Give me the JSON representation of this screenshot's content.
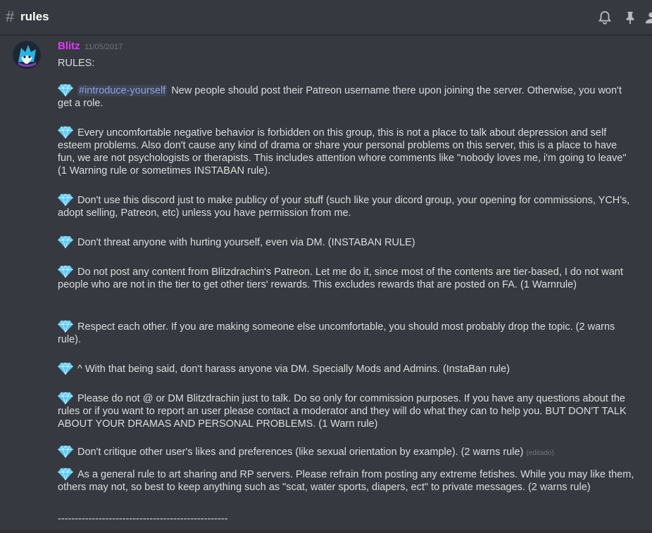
{
  "header": {
    "hash": "#",
    "channel": "rules"
  },
  "message": {
    "author": "Blitz",
    "timestamp": "11/05/2017",
    "author_color": "#e535ff",
    "title": "RULES:",
    "mention": "#introduce-yourself",
    "rules": [
      "New people should post their Patreon username  there upon joining the server. Otherwise, you won't get a role.",
      "Every uncomfortable negative behavior  is forbidden on this group, this is not a place to talk about depression and self esteem problems. Also don't cause any kind of drama or share your personal problems on this server, this is a place to have fun, we are not psychologists or therapists. This includes attention whore comments like \"nobody loves me, i'm going to leave\" (1 Warning rule or sometimes INSTABAN rule).",
      "Don't use this discord just to make publicy of your stuff (such like your dicord group, your opening for commissions, YCH's, adopt selling, Patreon, etc) unless you have permission from me.",
      "Don't threat anyone with hurting yourself, even via DM. (INSTABAN RULE)",
      "Do not post any content from Blitzdrachin's Patreon. Let me do it, since most of the contents are tier-based, I do not want people who are not in the tier to get other tiers' rewards. This excludes rewards that are posted on FA. (1 Warnrule)",
      "Respect each other. If you are making someone else uncomfortable, you should most probably drop the topic. (2 warns rule).",
      "^ With that being said, don't harass anyone via DM. Specially Mods and Admins.  (InstaBan rule)",
      "Please do not @ or DM Blitzdrachin just to talk. Do so only for commission purposes. If you have any questions about the rules or if you want to report an user please contact a moderator and they will do what they can to help you. BUT DON'T TALK ABOUT YOUR DRAMAS AND PERSONAL PROBLEMS.  (1 Warn rule)",
      "Don't critique other user's likes and preferences (like sexual orientation by example). (2 warns rule)",
      "As a general rule to art sharing and RP servers. Please refrain from posting any extreme fetishes. While you may like them, others may not, so best to keep anything such as \"scat, water sports, diapers, ect\" to private messages. (2 warns rule)"
    ],
    "edited_label": "(editado)",
    "divider": "--------------------------------------------------"
  },
  "icons": {
    "bell": "bell-icon",
    "pin": "pin-icon",
    "members": "members-icon",
    "gem": "gem-emoji"
  }
}
